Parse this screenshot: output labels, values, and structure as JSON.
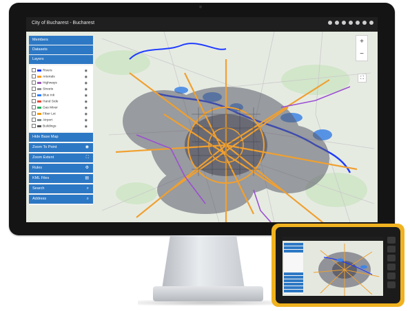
{
  "topbar": {
    "title": "City of Bucharest - Bucharest",
    "icons": [
      "share-icon",
      "print-icon",
      "location-icon",
      "layers-icon",
      "download-icon",
      "settings-icon",
      "refresh-icon"
    ]
  },
  "sidebar": {
    "top_buttons": [
      {
        "label": "Members"
      },
      {
        "label": "Datasets"
      },
      {
        "label": "Layers"
      }
    ],
    "layers": [
      {
        "label": "Rivers",
        "color": "#1f3cff"
      },
      {
        "label": "Arterials",
        "color": "#ff9a1f"
      },
      {
        "label": "Highways",
        "color": "#9b59b6"
      },
      {
        "label": "Streets",
        "color": "#8f8f8f"
      },
      {
        "label": "Blue Ink",
        "color": "#2c80ff"
      },
      {
        "label": "Hand Side",
        "color": "#e74c3c"
      },
      {
        "label": "Gas Mixer",
        "color": "#27ae60"
      },
      {
        "label": "Fiber Lst",
        "color": "#f39c12"
      },
      {
        "label": "Airport",
        "color": "#7f8c8d"
      },
      {
        "label": "Buildings",
        "color": "#555555"
      }
    ],
    "bottom_buttons": [
      {
        "label": "Hide Base Map",
        "icon": ""
      },
      {
        "label": "Zoom To Point",
        "icon": "◉"
      },
      {
        "label": "Zoom Extent",
        "icon": "⛶"
      },
      {
        "label": "Rules",
        "icon": "⚙"
      },
      {
        "label": "KML Files",
        "icon": "▤"
      },
      {
        "label": "Search",
        "icon": "⌕"
      },
      {
        "label": "Address",
        "icon": "⌕"
      }
    ]
  },
  "map_controls": {
    "zoom_in": "+",
    "zoom_out": "−",
    "fullscreen": "⛶"
  },
  "tablet": {
    "sidebar_labels": [
      "Members",
      "Datasets",
      "Layers",
      "Hide Base Map",
      "Zoom To Point",
      "Zoom Extent",
      "Rules",
      "KML Files",
      "Search",
      "Address"
    ]
  }
}
